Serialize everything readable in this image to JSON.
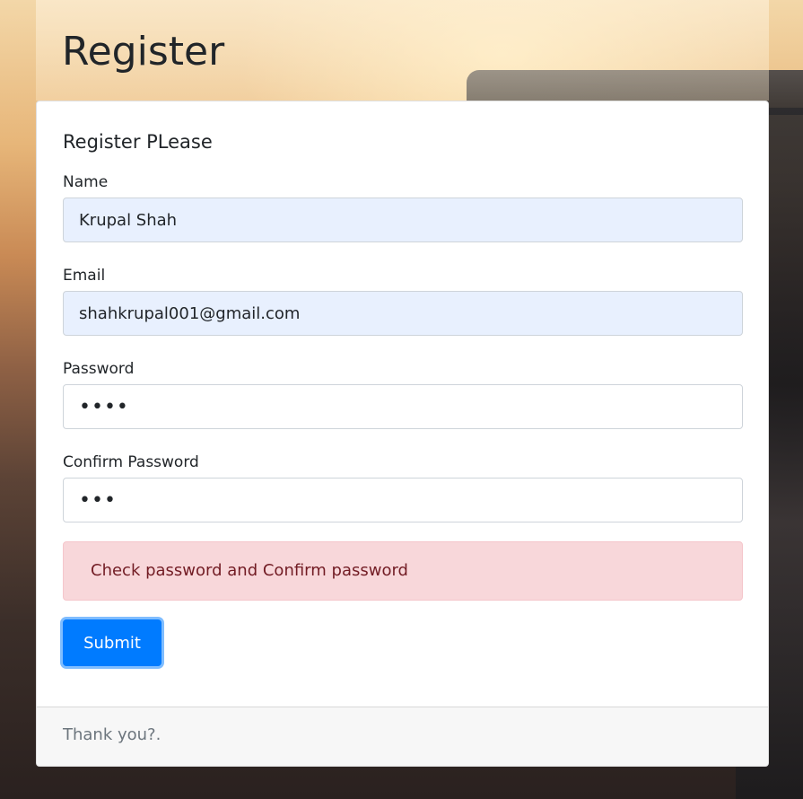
{
  "page": {
    "title": "Register"
  },
  "card": {
    "title": "Register PLease",
    "footer_text": "Thank you?."
  },
  "form": {
    "name_label": "Name",
    "name_value": "Krupal Shah",
    "email_label": "Email",
    "email_value": "shahkrupal001@gmail.com",
    "password_label": "Password",
    "password_value": "••••",
    "confirm_label": "Confirm Password",
    "confirm_value": "•••",
    "error_message": "Check password and Confirm password",
    "submit_label": "Submit"
  },
  "colors": {
    "primary": "#007bff",
    "alert_background": "#f8d7da",
    "alert_text": "#721c24",
    "autofill_background": "#e8f0fe"
  }
}
